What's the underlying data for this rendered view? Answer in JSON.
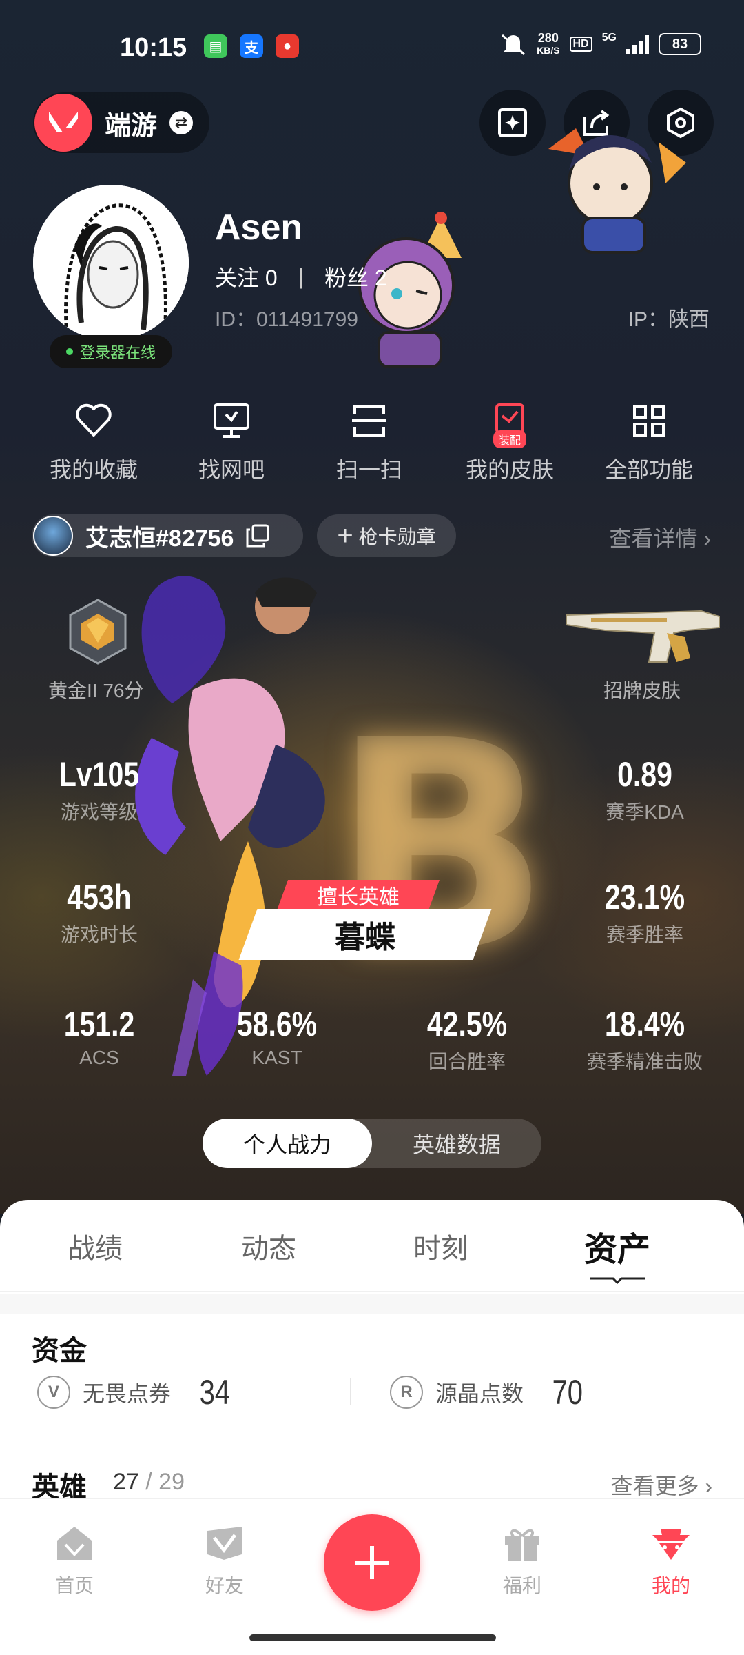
{
  "status": {
    "time": "10:15",
    "net_speed_value": "280",
    "net_speed_unit": "KB/S",
    "hd": "HD",
    "network": "5G",
    "battery": "83"
  },
  "header": {
    "app_name": "端游"
  },
  "profile": {
    "username": "Asen",
    "follow_label": "关注 0",
    "fans_label": "粉丝 2",
    "id_text": "ID：011491799",
    "ip_text": "IP：陕西",
    "online_text": "登录器在线"
  },
  "quick": [
    {
      "label": "我的收藏"
    },
    {
      "label": "找网吧"
    },
    {
      "label": "扫一扫"
    },
    {
      "label": "我的皮肤",
      "tag": "装配"
    },
    {
      "label": "全部功能"
    }
  ],
  "riot": {
    "name": "艾志恒#82756",
    "card_label": "枪卡勋章",
    "detail_label": "查看详情"
  },
  "rank": {
    "label": "黄金II 76分"
  },
  "skin": {
    "label": "招牌皮肤"
  },
  "stats": {
    "level": {
      "value": "Lv105",
      "label": "游戏等级"
    },
    "kda": {
      "value": "0.89",
      "label": "赛季KDA"
    },
    "hours": {
      "value": "453h",
      "label": "游戏时长"
    },
    "winrate": {
      "value": "23.1%",
      "label": "赛季胜率"
    },
    "acs": {
      "value": "151.2",
      "label": "ACS"
    },
    "kast": {
      "value": "58.6%",
      "label": "KAST"
    },
    "round_win": {
      "value": "42.5%",
      "label": "回合胜率"
    },
    "precision": {
      "value": "18.4%",
      "label": "赛季精准击败"
    }
  },
  "hero": {
    "tag": "擅长英雄",
    "name": "暮蝶",
    "grade": "B"
  },
  "segment": {
    "active": "个人战力",
    "inactive": "英雄数据"
  },
  "tabs": [
    {
      "label": "战绩"
    },
    {
      "label": "动态"
    },
    {
      "label": "时刻"
    },
    {
      "label": "资产"
    }
  ],
  "funds": {
    "title": "资金",
    "vp": {
      "label": "无畏点券",
      "value": "34"
    },
    "rp": {
      "label": "源晶点数",
      "value": "70"
    }
  },
  "heroes": {
    "title": "英雄",
    "owned": "27",
    "total": "/ 29",
    "more": "查看更多"
  },
  "nav": [
    {
      "label": "首页"
    },
    {
      "label": "好友"
    },
    {
      "label": "福利"
    },
    {
      "label": "我的"
    }
  ],
  "colors": {
    "accent": "#ff4655"
  }
}
